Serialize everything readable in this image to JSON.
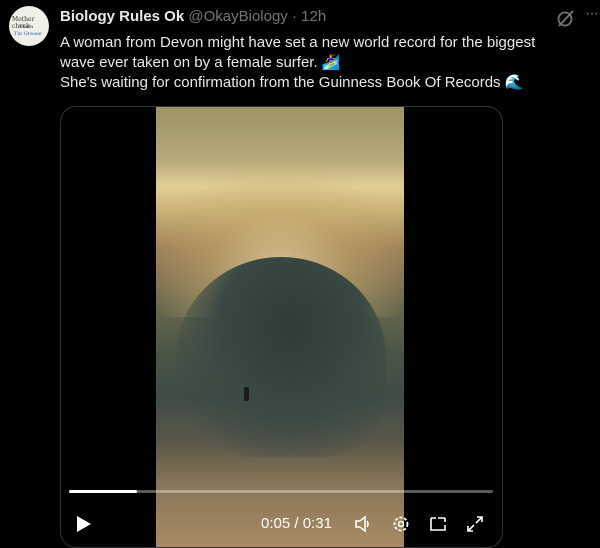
{
  "tweet": {
    "author_name": "Biology Rules Ok",
    "handle": "@OkayBiology",
    "separator": "·",
    "time": "12h",
    "text_line1": "A woman from Devon might have set a new world record for the biggest",
    "text_line2": "wave ever taken on by a female surfer. 🏄‍♀️",
    "text_line3": "She's waiting for confirmation from the Guinness Book Of Records 🌊",
    "more_label": "···"
  },
  "avatar": {
    "line1": "Mother check",
    "line2": "Them",
    "line3": "Tin Grease"
  },
  "video": {
    "current_time": "0:05",
    "separator": " / ",
    "duration": "0:31",
    "progress_fraction": 0.16,
    "icons": [
      "play-icon",
      "volume-icon",
      "settings-icon",
      "pip-icon",
      "fullscreen-icon"
    ]
  }
}
